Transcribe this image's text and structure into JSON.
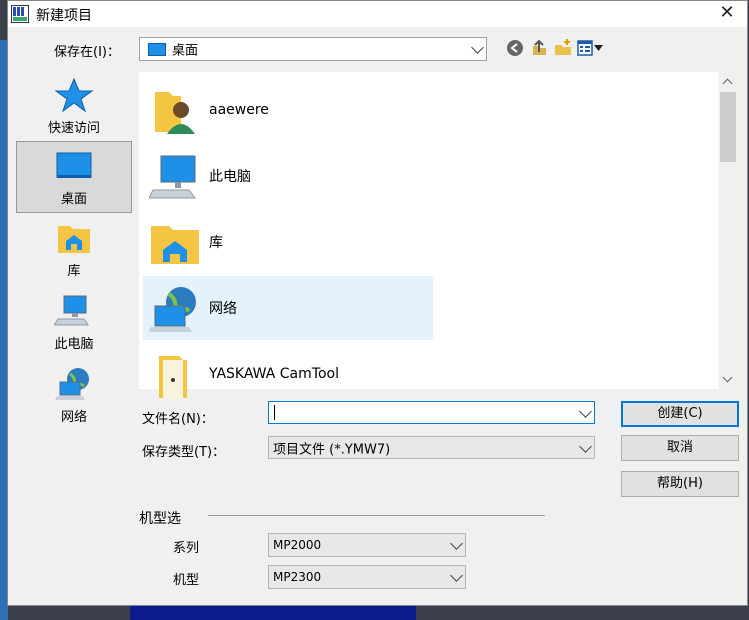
{
  "window": {
    "title": "新建项目",
    "close_glyph": "✕"
  },
  "location": {
    "label": "保存在(I)：",
    "value": "桌面"
  },
  "toolbar": {
    "back_icon": "back-arrow-icon",
    "up_icon": "up-folder-icon",
    "new_folder_icon": "new-folder-icon",
    "view_icon": "view-menu-icon"
  },
  "places": [
    {
      "label": "快速访问",
      "icon": "star-icon"
    },
    {
      "label": "桌面",
      "icon": "desktop-icon",
      "selected": true
    },
    {
      "label": "库",
      "icon": "library-icon"
    },
    {
      "label": "此电脑",
      "icon": "computer-icon"
    },
    {
      "label": "网络",
      "icon": "network-icon"
    }
  ],
  "files": [
    {
      "name": "aaewere",
      "icon": "user-folder-icon"
    },
    {
      "name": "此电脑",
      "icon": "computer-icon"
    },
    {
      "name": "库",
      "icon": "library-icon"
    },
    {
      "name": "网络",
      "icon": "network-icon",
      "highlighted": true
    },
    {
      "name": "YASKAWA CamTool",
      "icon": "folder-icon"
    }
  ],
  "filename": {
    "label": "文件名(N)：",
    "value": ""
  },
  "filetype": {
    "label": "保存类型(T)：",
    "value": "项目文件 (*.YMW7)"
  },
  "buttons": {
    "create": "创建(C)",
    "cancel": "取消",
    "help": "帮助(H)"
  },
  "model_select": {
    "group_label": "机型选",
    "series_label": "系列",
    "series_value": "MP2000",
    "model_label": "机型",
    "model_value": "MP2300"
  }
}
